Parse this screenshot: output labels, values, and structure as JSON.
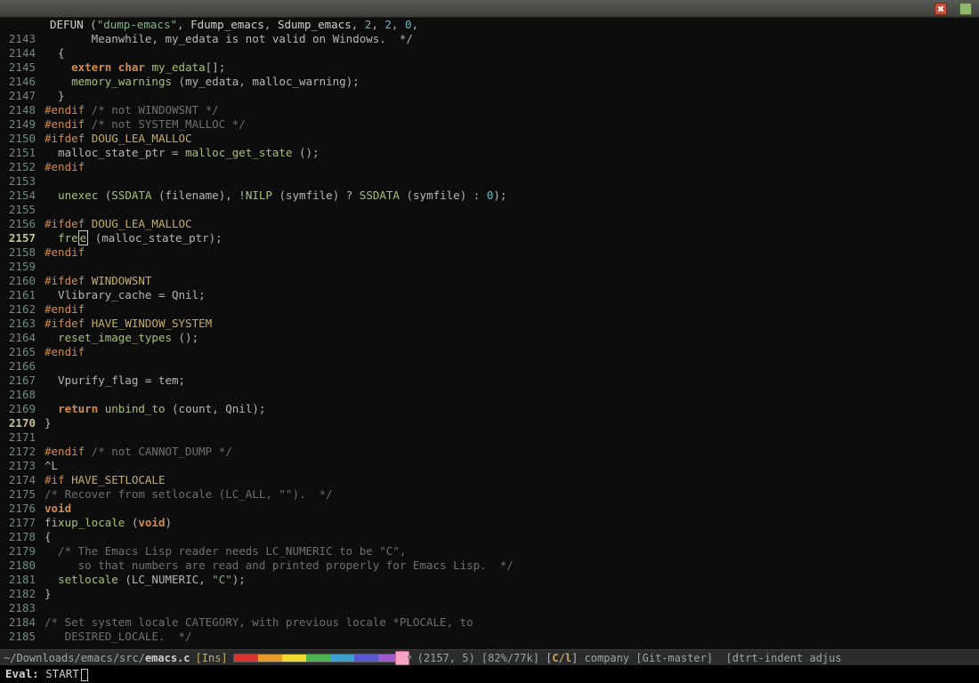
{
  "titlebar": {
    "close_tip": "Close",
    "max_tip": "Maximize"
  },
  "breadcrumb": {
    "defun": "DEFUN",
    "name": "\"dump-emacs\"",
    "fsym": "Fdump_emacs",
    "ssym": "Sdump_emacs",
    "n1": "2",
    "n2": "2",
    "n3": "0",
    "tail": ","
  },
  "lines": [
    {
      "n": "2143",
      "tokens": [
        [
          "var",
          "       Meanwhile, my_edata is not valid on Windows.  */"
        ]
      ]
    },
    {
      "n": "2144",
      "tokens": [
        [
          "pun",
          "  {"
        ]
      ]
    },
    {
      "n": "2145",
      "tokens": [
        [
          "var",
          "    "
        ],
        [
          "kw",
          "extern"
        ],
        [
          "var",
          " "
        ],
        [
          "kw",
          "char"
        ],
        [
          "var",
          " "
        ],
        [
          "fnc",
          "my_edata"
        ],
        [
          "pun",
          "[];"
        ]
      ]
    },
    {
      "n": "2146",
      "tokens": [
        [
          "var",
          "    "
        ],
        [
          "fnc",
          "memory_warnings"
        ],
        [
          "pun",
          " ("
        ],
        [
          "var",
          "my_edata"
        ],
        [
          "pun",
          ", "
        ],
        [
          "var",
          "malloc_warning"
        ],
        [
          "pun",
          ");"
        ]
      ]
    },
    {
      "n": "2147",
      "tokens": [
        [
          "pun",
          "  }"
        ]
      ]
    },
    {
      "n": "2148",
      "tokens": [
        [
          "pp",
          "#endif"
        ],
        [
          "cm",
          " /* not WINDOWSNT */"
        ]
      ]
    },
    {
      "n": "2149",
      "tokens": [
        [
          "pp",
          "#endif"
        ],
        [
          "cm",
          " /* not SYSTEM_MALLOC */"
        ]
      ]
    },
    {
      "n": "2150",
      "tokens": [
        [
          "pp",
          "#ifdef"
        ],
        [
          "var",
          " "
        ],
        [
          "cv",
          "DOUG_LEA_MALLOC"
        ]
      ]
    },
    {
      "n": "2151",
      "tokens": [
        [
          "var",
          "  "
        ],
        [
          "var",
          "malloc_state_ptr"
        ],
        [
          "pun",
          " = "
        ],
        [
          "fnc",
          "malloc_get_state"
        ],
        [
          "pun",
          " ();"
        ]
      ]
    },
    {
      "n": "2152",
      "tokens": [
        [
          "pp",
          "#endif"
        ]
      ]
    },
    {
      "n": "2153",
      "tokens": [
        [
          "var",
          ""
        ]
      ]
    },
    {
      "n": "2154",
      "tokens": [
        [
          "var",
          "  "
        ],
        [
          "fnc",
          "unexec"
        ],
        [
          "pun",
          " ("
        ],
        [
          "fnc",
          "SSDATA"
        ],
        [
          "pun",
          " ("
        ],
        [
          "var",
          "filename"
        ],
        [
          "pun",
          "), !"
        ],
        [
          "fnc",
          "NILP"
        ],
        [
          "pun",
          " ("
        ],
        [
          "var",
          "symfile"
        ],
        [
          "pun",
          ") ? "
        ],
        [
          "fnc",
          "SSDATA"
        ],
        [
          "pun",
          " ("
        ],
        [
          "var",
          "symfile"
        ],
        [
          "pun",
          ") : "
        ],
        [
          "num",
          "0"
        ],
        [
          "pun",
          ");"
        ]
      ]
    },
    {
      "n": "2155",
      "tokens": [
        [
          "var",
          ""
        ]
      ]
    },
    {
      "n": "2156",
      "tokens": [
        [
          "pp",
          "#ifdef"
        ],
        [
          "var",
          " "
        ],
        [
          "cv",
          "DOUG_LEA_MALLOC"
        ]
      ]
    },
    {
      "n": "2157",
      "cur": true,
      "tokens": [
        [
          "var",
          "  "
        ],
        [
          "fnc",
          "fre"
        ],
        [
          "cursor",
          "e"
        ],
        [
          "pun",
          " ("
        ],
        [
          "var",
          "malloc_state_ptr"
        ],
        [
          "pun",
          ");"
        ]
      ]
    },
    {
      "n": "2158",
      "tokens": [
        [
          "pp",
          "#endif"
        ]
      ]
    },
    {
      "n": "2159",
      "tokens": [
        [
          "var",
          ""
        ]
      ]
    },
    {
      "n": "2160",
      "tokens": [
        [
          "pp",
          "#ifdef"
        ],
        [
          "var",
          " "
        ],
        [
          "cv",
          "WINDOWSNT"
        ]
      ]
    },
    {
      "n": "2161",
      "tokens": [
        [
          "var",
          "  Vlibrary_cache = Qnil;"
        ]
      ]
    },
    {
      "n": "2162",
      "tokens": [
        [
          "pp",
          "#endif"
        ]
      ]
    },
    {
      "n": "2163",
      "tokens": [
        [
          "pp",
          "#ifdef"
        ],
        [
          "var",
          " "
        ],
        [
          "cv",
          "HAVE_WINDOW_SYSTEM"
        ]
      ]
    },
    {
      "n": "2164",
      "tokens": [
        [
          "var",
          "  "
        ],
        [
          "fnc",
          "reset_image_types"
        ],
        [
          "pun",
          " ();"
        ]
      ]
    },
    {
      "n": "2165",
      "tokens": [
        [
          "pp",
          "#endif"
        ]
      ]
    },
    {
      "n": "2166",
      "tokens": [
        [
          "var",
          ""
        ]
      ]
    },
    {
      "n": "2167",
      "tokens": [
        [
          "var",
          "  Vpurify_flag = tem;"
        ]
      ]
    },
    {
      "n": "2168",
      "tokens": [
        [
          "var",
          ""
        ]
      ]
    },
    {
      "n": "2169",
      "tokens": [
        [
          "var",
          "  "
        ],
        [
          "kw",
          "return"
        ],
        [
          "var",
          " "
        ],
        [
          "fnc",
          "unbind_to"
        ],
        [
          "pun",
          " ("
        ],
        [
          "var",
          "count"
        ],
        [
          "pun",
          ", Qnil);"
        ]
      ]
    },
    {
      "n": "2170",
      "cur": true,
      "tokens": [
        [
          "pun",
          "}"
        ]
      ]
    },
    {
      "n": "2171",
      "tokens": [
        [
          "var",
          ""
        ]
      ]
    },
    {
      "n": "2172",
      "tokens": [
        [
          "pp",
          "#endif"
        ],
        [
          "cm",
          " /* not CANNOT_DUMP */"
        ]
      ]
    },
    {
      "n": "2173",
      "tokens": [
        [
          "var",
          "^L"
        ]
      ]
    },
    {
      "n": "2174",
      "tokens": [
        [
          "pp",
          "#if"
        ],
        [
          "var",
          " "
        ],
        [
          "cv",
          "HAVE_SETLOCALE"
        ]
      ]
    },
    {
      "n": "2175",
      "tokens": [
        [
          "cm",
          "/* Recover from setlocale (LC_ALL, \"\").  */"
        ]
      ]
    },
    {
      "n": "2176",
      "tokens": [
        [
          "kw",
          "void"
        ]
      ]
    },
    {
      "n": "2177",
      "tokens": [
        [
          "fnc",
          "fixup_locale"
        ],
        [
          "pun",
          " ("
        ],
        [
          "kw",
          "void"
        ],
        [
          "pun",
          ")"
        ]
      ]
    },
    {
      "n": "2178",
      "tokens": [
        [
          "pun",
          "{"
        ]
      ]
    },
    {
      "n": "2179",
      "tokens": [
        [
          "cm",
          "  /* The Emacs Lisp reader needs LC_NUMERIC to be \"C\","
        ]
      ]
    },
    {
      "n": "2180",
      "tokens": [
        [
          "cm",
          "     so that numbers are read and printed properly for Emacs Lisp.  */"
        ]
      ]
    },
    {
      "n": "2181",
      "tokens": [
        [
          "var",
          "  "
        ],
        [
          "fnc",
          "setlocale"
        ],
        [
          "pun",
          " ("
        ],
        [
          "var",
          "LC_NUMERIC"
        ],
        [
          "pun",
          ", "
        ],
        [
          "str",
          "\"C\""
        ],
        [
          "pun",
          ");"
        ]
      ]
    },
    {
      "n": "2182",
      "tokens": [
        [
          "pun",
          "}"
        ]
      ]
    },
    {
      "n": "2183",
      "tokens": [
        [
          "var",
          ""
        ]
      ]
    },
    {
      "n": "2184",
      "tokens": [
        [
          "cm",
          "/* Set system locale CATEGORY, with previous locale *PLOCALE, to"
        ]
      ]
    },
    {
      "n": "2185",
      "tokens": [
        [
          "cm",
          "   DESIRED_LOCALE.  */"
        ]
      ]
    }
  ],
  "modeline": {
    "dash": " ",
    "path": "~/Downloads/emacs/src/",
    "file": "emacs.c",
    "ins": "[Ins]",
    "position": "(2157, 5)",
    "percent": "[82%/77k]",
    "major_open": "[",
    "major": "C/l",
    "major_close": "]",
    "minor1": "company",
    "git": "[Git-master]",
    "minor2": "[dtrt-indent adjus"
  },
  "minibuffer": {
    "prompt": "Eval: ",
    "value": "START"
  }
}
